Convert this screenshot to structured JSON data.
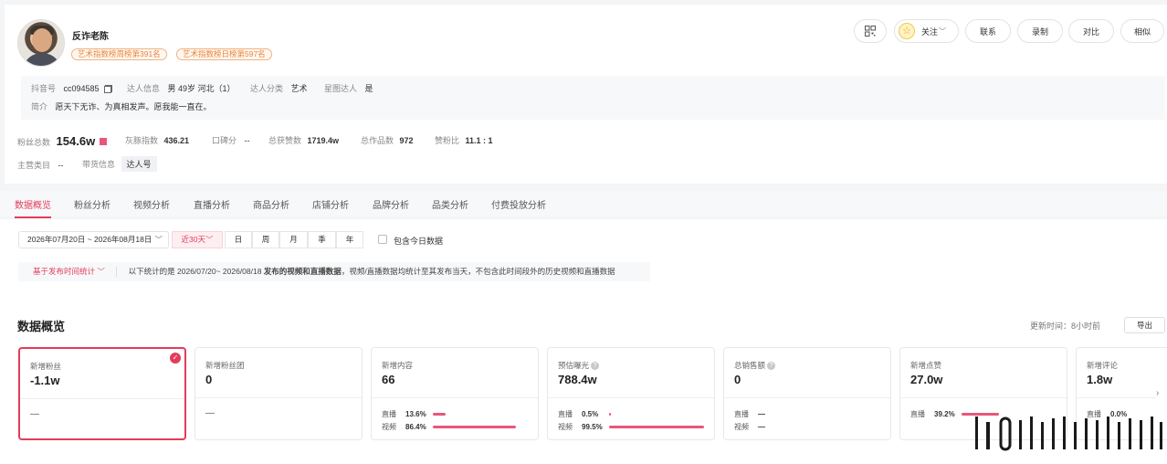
{
  "profile": {
    "name": "反诈老陈",
    "badges": [
      "艺术指数榜周榜第391名",
      "艺术指数榜日榜第597名"
    ],
    "douyin_id_label": "抖音号",
    "douyin_id": "cc094585",
    "talent_info_label": "达人信息",
    "talent_info": "男 49岁 河北（1）",
    "category_label": "达人分类",
    "category": "艺术",
    "star_label": "星图达人",
    "star": "是",
    "intro_label": "简介",
    "intro": "愿天下无诈、为真相发声。愿我能一直在。"
  },
  "top_actions": {
    "follow": "关注",
    "contact": "联系",
    "record": "录制",
    "compare": "对比",
    "similar": "相似"
  },
  "stats": {
    "fans_label": "粉丝总数",
    "fans": "154.6w",
    "index_label": "灰豚指数",
    "index": "436.21",
    "rep_label": "口碑分",
    "rep": "--",
    "likes_label": "总获赞数",
    "likes": "1719.4w",
    "works_label": "总作品数",
    "works": "972",
    "ratio_label": "赞粉比",
    "ratio": "11.1 : 1",
    "main_cat_label": "主营类目",
    "main_cat": "--",
    "goods_label": "带货信息",
    "goods": "达人号"
  },
  "tabs": [
    "数据概览",
    "粉丝分析",
    "视频分析",
    "直播分析",
    "商品分析",
    "店铺分析",
    "品牌分析",
    "品类分析",
    "付费投放分析"
  ],
  "filters": {
    "date_range": "2026年07月20日 ~ 2026年08月18日",
    "periods": [
      "近30天",
      "日",
      "周",
      "月",
      "季",
      "年"
    ],
    "include_today": "包含今日数据",
    "basis": "基于发布时间统计",
    "notice_prefix": "以下统计的是 2026/07/20~ 2026/08/18 ",
    "notice_bold": "发布的视频和直播数据",
    "notice_suffix": "，视频/直播数据均统计至其发布当天，不包含此时间段外的历史视频和直播数据"
  },
  "overview": {
    "title": "数据概览",
    "updated": "更新时间：8小时前",
    "export": "导出"
  },
  "metrics": [
    {
      "label": "新增粉丝",
      "value": "-1.1w",
      "dash": "—"
    },
    {
      "label": "新增粉丝团",
      "value": "0",
      "dash": "—"
    },
    {
      "label": "新增内容",
      "value": "66",
      "live_label": "直播",
      "live": "13.6%",
      "live_pct": 13.6,
      "video_label": "视频",
      "video": "86.4%",
      "video_pct": 86.4
    },
    {
      "label": "预估曝光",
      "value": "788.4w",
      "help": true,
      "live_label": "直播",
      "live": "0.5%",
      "live_pct": 0.5,
      "video_label": "视频",
      "video": "99.5%",
      "video_pct": 99.5
    },
    {
      "label": "总销售额",
      "value": "0",
      "help": true,
      "live_label": "直播",
      "live": "—",
      "live_pct": 0,
      "video_label": "视频",
      "video": "—",
      "video_pct": 0
    },
    {
      "label": "新增点赞",
      "value": "27.0w",
      "live_label": "直播",
      "live": "39.2%",
      "live_pct": 39.2
    },
    {
      "label": "新增评论",
      "value": "1.8w",
      "live_label": "直播",
      "live": "0.0%",
      "live_pct": 0
    }
  ],
  "colors": {
    "accent": "#e23c5a",
    "badge": "#e8833a",
    "bar": "#e8577a"
  }
}
